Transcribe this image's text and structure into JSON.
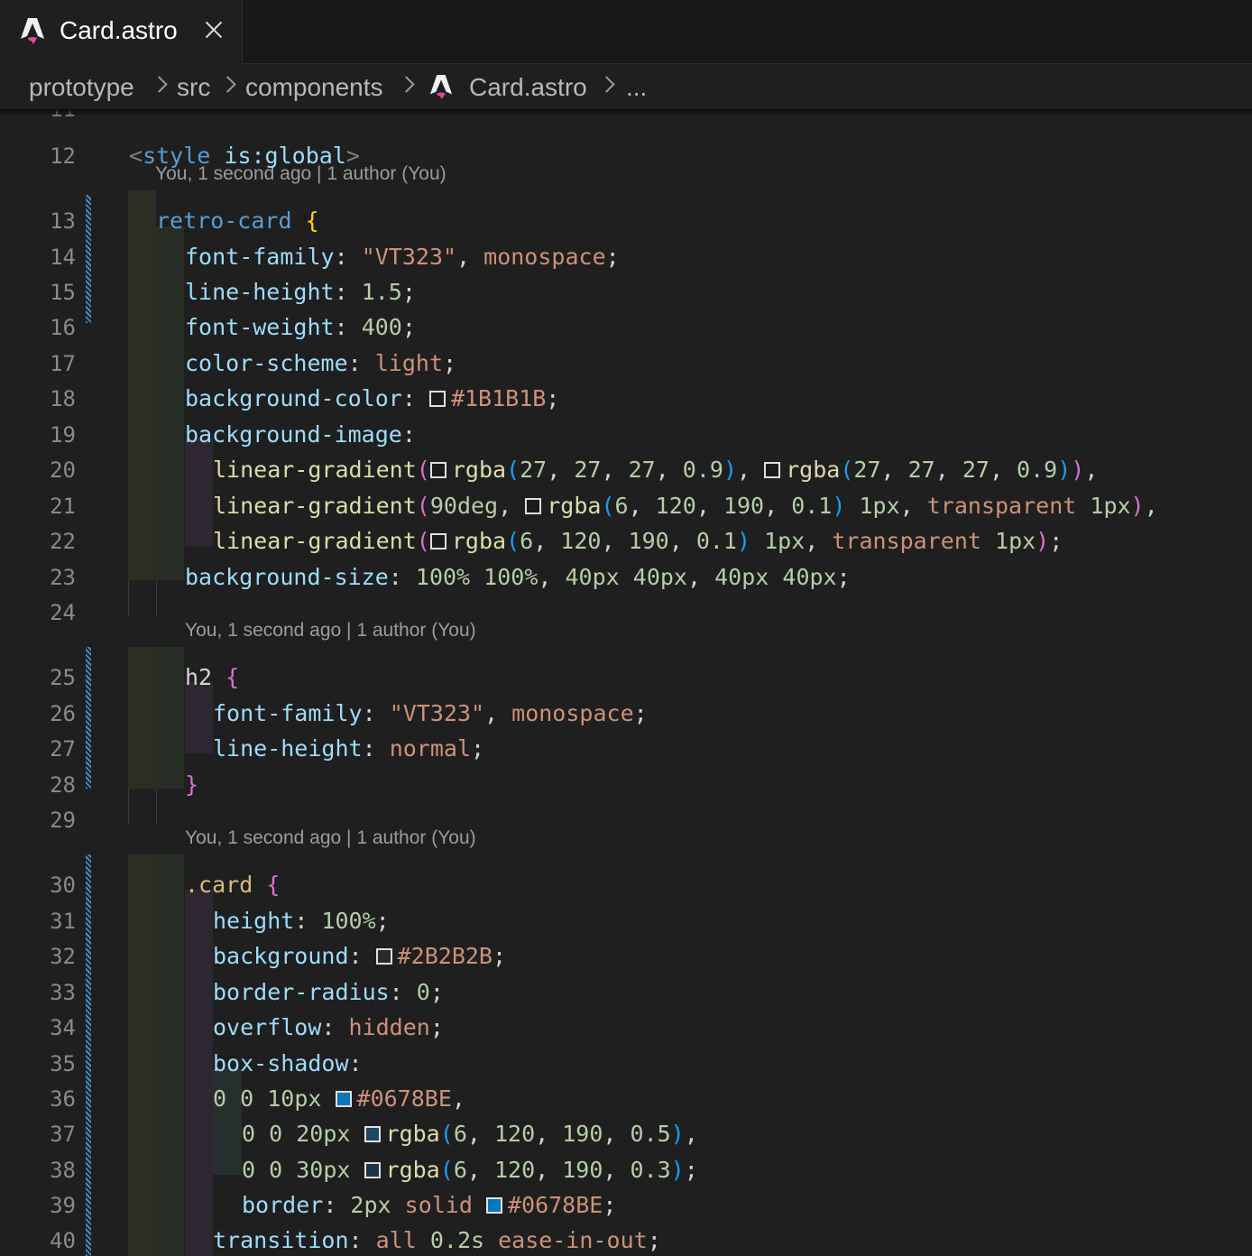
{
  "tab": {
    "label": "Card.astro",
    "logo_icon": "astro-logo-icon",
    "close_icon": "close-icon"
  },
  "breadcrumb": {
    "items": [
      "prototype",
      "src",
      "components",
      "Card.astro",
      "..."
    ]
  },
  "editor": {
    "top_partial_line": "11",
    "blame": [
      "You, 1 second ago | 1 author (You)",
      "You, 1 second ago | 1 author (You)",
      "You, 1 second ago | 1 author (You)"
    ],
    "lines": [
      {
        "n": "12",
        "tokens": [
          [
            "<",
            "t-punc"
          ],
          [
            "style",
            "t-tag"
          ],
          [
            " ",
            "t-plain"
          ],
          [
            "is:global",
            "t-prop"
          ],
          [
            ">",
            "t-punc"
          ]
        ]
      },
      {
        "n": "13",
        "tokens": [
          [
            "retro-card",
            "t-tag"
          ],
          [
            " ",
            "t-plain"
          ],
          [
            "{",
            "t-br1"
          ]
        ]
      },
      {
        "n": "14",
        "tokens": [
          [
            "font-family",
            "t-prop"
          ],
          [
            ": ",
            "t-plain"
          ],
          [
            "\"VT323\"",
            "t-str"
          ],
          [
            ", ",
            "t-plain"
          ],
          [
            "monospace",
            "t-str"
          ],
          [
            ";",
            "t-plain"
          ]
        ]
      },
      {
        "n": "15",
        "tokens": [
          [
            "line-height",
            "t-prop"
          ],
          [
            ": ",
            "t-plain"
          ],
          [
            "1.5",
            "t-num"
          ],
          [
            ";",
            "t-plain"
          ]
        ]
      },
      {
        "n": "16",
        "tokens": [
          [
            "font-weight",
            "t-prop"
          ],
          [
            ": ",
            "t-plain"
          ],
          [
            "400",
            "t-num"
          ],
          [
            ";",
            "t-plain"
          ]
        ]
      },
      {
        "n": "17",
        "tokens": [
          [
            "color-scheme",
            "t-prop"
          ],
          [
            ": ",
            "t-plain"
          ],
          [
            "light",
            "t-str"
          ],
          [
            ";",
            "t-plain"
          ]
        ]
      },
      {
        "n": "18",
        "tokens": [
          [
            "background-color",
            "t-prop"
          ],
          [
            ": ",
            "t-plain"
          ],
          [
            "SW:#1B1B1B",
            "sw"
          ],
          [
            "#1B1B1B",
            "t-str"
          ],
          [
            ";",
            "t-plain"
          ]
        ]
      },
      {
        "n": "19",
        "tokens": [
          [
            "background-image",
            "t-prop"
          ],
          [
            ":",
            "t-plain"
          ]
        ]
      },
      {
        "n": "20",
        "tokens": [
          [
            "linear-gradient",
            "t-fn"
          ],
          [
            "(",
            "t-br2"
          ],
          [
            "SW:#1b1b1b",
            "sw"
          ],
          [
            "rgba",
            "t-fn"
          ],
          [
            "(",
            "t-br3"
          ],
          [
            "27",
            "t-num"
          ],
          [
            ", ",
            "t-plain"
          ],
          [
            "27",
            "t-num"
          ],
          [
            ", ",
            "t-plain"
          ],
          [
            "27",
            "t-num"
          ],
          [
            ", ",
            "t-plain"
          ],
          [
            "0.9",
            "t-num"
          ],
          [
            ")",
            "t-br3"
          ],
          [
            ", ",
            "t-plain"
          ],
          [
            "SW:#1b1b1b",
            "sw"
          ],
          [
            "rgba",
            "t-fn"
          ],
          [
            "(",
            "t-br3"
          ],
          [
            "27",
            "t-num"
          ],
          [
            ", ",
            "t-plain"
          ],
          [
            "27",
            "t-num"
          ],
          [
            ", ",
            "t-plain"
          ],
          [
            "27",
            "t-num"
          ],
          [
            ", ",
            "t-plain"
          ],
          [
            "0.9",
            "t-num"
          ],
          [
            ")",
            "t-br3"
          ],
          [
            ")",
            "t-br2"
          ],
          [
            ",",
            "t-plain"
          ]
        ]
      },
      {
        "n": "21",
        "tokens": [
          [
            "linear-gradient",
            "t-fn"
          ],
          [
            "(",
            "t-br2"
          ],
          [
            "90deg",
            "t-num"
          ],
          [
            ", ",
            "t-plain"
          ],
          [
            "SW:#1b1b1b",
            "sw"
          ],
          [
            "rgba",
            "t-fn"
          ],
          [
            "(",
            "t-br3"
          ],
          [
            "6",
            "t-num"
          ],
          [
            ", ",
            "t-plain"
          ],
          [
            "120",
            "t-num"
          ],
          [
            ", ",
            "t-plain"
          ],
          [
            "190",
            "t-num"
          ],
          [
            ", ",
            "t-plain"
          ],
          [
            "0.1",
            "t-num"
          ],
          [
            ")",
            "t-br3"
          ],
          [
            " ",
            "t-plain"
          ],
          [
            "1px",
            "t-num"
          ],
          [
            ", ",
            "t-plain"
          ],
          [
            "transparent",
            "t-str"
          ],
          [
            " ",
            "t-plain"
          ],
          [
            "1px",
            "t-num"
          ],
          [
            ")",
            "t-br2"
          ],
          [
            ",",
            "t-plain"
          ]
        ]
      },
      {
        "n": "22",
        "tokens": [
          [
            "linear-gradient",
            "t-fn"
          ],
          [
            "(",
            "t-br2"
          ],
          [
            "SW:#1b1b1b",
            "sw"
          ],
          [
            "rgba",
            "t-fn"
          ],
          [
            "(",
            "t-br3"
          ],
          [
            "6",
            "t-num"
          ],
          [
            ", ",
            "t-plain"
          ],
          [
            "120",
            "t-num"
          ],
          [
            ", ",
            "t-plain"
          ],
          [
            "190",
            "t-num"
          ],
          [
            ", ",
            "t-plain"
          ],
          [
            "0.1",
            "t-num"
          ],
          [
            ")",
            "t-br3"
          ],
          [
            " ",
            "t-plain"
          ],
          [
            "1px",
            "t-num"
          ],
          [
            ", ",
            "t-plain"
          ],
          [
            "transparent",
            "t-str"
          ],
          [
            " ",
            "t-plain"
          ],
          [
            "1px",
            "t-num"
          ],
          [
            ")",
            "t-br2"
          ],
          [
            ";",
            "t-plain"
          ]
        ]
      },
      {
        "n": "23",
        "tokens": [
          [
            "background-size",
            "t-prop"
          ],
          [
            ": ",
            "t-plain"
          ],
          [
            "100%",
            "t-num"
          ],
          [
            " ",
            "t-plain"
          ],
          [
            "100%",
            "t-num"
          ],
          [
            ", ",
            "t-plain"
          ],
          [
            "40px",
            "t-num"
          ],
          [
            " ",
            "t-plain"
          ],
          [
            "40px",
            "t-num"
          ],
          [
            ", ",
            "t-plain"
          ],
          [
            "40px",
            "t-num"
          ],
          [
            " ",
            "t-plain"
          ],
          [
            "40px",
            "t-num"
          ],
          [
            ";",
            "t-plain"
          ]
        ]
      },
      {
        "n": "24",
        "tokens": []
      },
      {
        "n": "25",
        "tokens": [
          [
            "h2",
            "t-plain"
          ],
          [
            " ",
            "t-plain"
          ],
          [
            "{",
            "t-br2"
          ]
        ]
      },
      {
        "n": "26",
        "tokens": [
          [
            "font-family",
            "t-prop"
          ],
          [
            ": ",
            "t-plain"
          ],
          [
            "\"VT323\"",
            "t-str"
          ],
          [
            ", ",
            "t-plain"
          ],
          [
            "monospace",
            "t-str"
          ],
          [
            ";",
            "t-plain"
          ]
        ]
      },
      {
        "n": "27",
        "tokens": [
          [
            "line-height",
            "t-prop"
          ],
          [
            ": ",
            "t-plain"
          ],
          [
            "normal",
            "t-str"
          ],
          [
            ";",
            "t-plain"
          ]
        ]
      },
      {
        "n": "28",
        "tokens": [
          [
            "}",
            "t-br2"
          ]
        ]
      },
      {
        "n": "29",
        "tokens": []
      },
      {
        "n": "30",
        "tokens": [
          [
            ".card",
            "t-cls"
          ],
          [
            " ",
            "t-plain"
          ],
          [
            "{",
            "t-br2"
          ]
        ]
      },
      {
        "n": "31",
        "tokens": [
          [
            "height",
            "t-prop"
          ],
          [
            ": ",
            "t-plain"
          ],
          [
            "100%",
            "t-num"
          ],
          [
            ";",
            "t-plain"
          ]
        ]
      },
      {
        "n": "32",
        "tokens": [
          [
            "background",
            "t-prop"
          ],
          [
            ": ",
            "t-plain"
          ],
          [
            "SW:#2B2B2B",
            "sw"
          ],
          [
            "#2B2B2B",
            "t-str"
          ],
          [
            ";",
            "t-plain"
          ]
        ]
      },
      {
        "n": "33",
        "tokens": [
          [
            "border-radius",
            "t-prop"
          ],
          [
            ": ",
            "t-plain"
          ],
          [
            "0",
            "t-num"
          ],
          [
            ";",
            "t-plain"
          ]
        ]
      },
      {
        "n": "34",
        "tokens": [
          [
            "overflow",
            "t-prop"
          ],
          [
            ": ",
            "t-plain"
          ],
          [
            "hidden",
            "t-str"
          ],
          [
            ";",
            "t-plain"
          ]
        ]
      },
      {
        "n": "35",
        "tokens": [
          [
            "box-shadow",
            "t-prop"
          ],
          [
            ":",
            "t-plain"
          ]
        ]
      },
      {
        "n": "36",
        "tokens": [
          [
            "0",
            "t-num"
          ],
          [
            " ",
            "t-plain"
          ],
          [
            "0",
            "t-num"
          ],
          [
            " ",
            "t-plain"
          ],
          [
            "10px",
            "t-num"
          ],
          [
            " ",
            "t-plain"
          ],
          [
            "SW:#0678BE",
            "sw"
          ],
          [
            "#0678BE",
            "t-str"
          ],
          [
            ",",
            "t-plain"
          ]
        ]
      },
      {
        "n": "37",
        "tokens": [
          [
            "0",
            "t-num"
          ],
          [
            " ",
            "t-plain"
          ],
          [
            "0",
            "t-num"
          ],
          [
            " ",
            "t-plain"
          ],
          [
            "20px",
            "t-num"
          ],
          [
            " ",
            "t-plain"
          ],
          [
            "SW:#1f4766",
            "sw"
          ],
          [
            "rgba",
            "t-fn"
          ],
          [
            "(",
            "t-br3"
          ],
          [
            "6",
            "t-num"
          ],
          [
            ", ",
            "t-plain"
          ],
          [
            "120",
            "t-num"
          ],
          [
            ", ",
            "t-plain"
          ],
          [
            "190",
            "t-num"
          ],
          [
            ", ",
            "t-plain"
          ],
          [
            "0.5",
            "t-num"
          ],
          [
            ")",
            "t-br3"
          ],
          [
            ",",
            "t-plain"
          ]
        ]
      },
      {
        "n": "38",
        "tokens": [
          [
            "0",
            "t-num"
          ],
          [
            " ",
            "t-plain"
          ],
          [
            "0",
            "t-num"
          ],
          [
            " ",
            "t-plain"
          ],
          [
            "30px",
            "t-num"
          ],
          [
            " ",
            "t-plain"
          ],
          [
            "SW:#1c3447",
            "sw"
          ],
          [
            "rgba",
            "t-fn"
          ],
          [
            "(",
            "t-br3"
          ],
          [
            "6",
            "t-num"
          ],
          [
            ", ",
            "t-plain"
          ],
          [
            "120",
            "t-num"
          ],
          [
            ", ",
            "t-plain"
          ],
          [
            "190",
            "t-num"
          ],
          [
            ", ",
            "t-plain"
          ],
          [
            "0.3",
            "t-num"
          ],
          [
            ")",
            "t-br3"
          ],
          [
            ";",
            "t-plain"
          ]
        ]
      },
      {
        "n": "39",
        "tokens": [
          [
            "border",
            "t-prop"
          ],
          [
            ": ",
            "t-plain"
          ],
          [
            "2px",
            "t-num"
          ],
          [
            " ",
            "t-plain"
          ],
          [
            "solid",
            "t-str"
          ],
          [
            " ",
            "t-plain"
          ],
          [
            "SW:#0678BE",
            "sw"
          ],
          [
            "#0678BE",
            "t-str"
          ],
          [
            ";",
            "t-plain"
          ]
        ]
      },
      {
        "n": "40",
        "tokens": [
          [
            "transition",
            "t-prop"
          ],
          [
            ": ",
            "t-plain"
          ],
          [
            "all",
            "t-str"
          ],
          [
            " ",
            "t-plain"
          ],
          [
            "0.2s",
            "t-num"
          ],
          [
            " ",
            "t-plain"
          ],
          [
            "ease-in-out",
            "t-str"
          ],
          [
            ";",
            "t-plain"
          ]
        ]
      }
    ]
  }
}
